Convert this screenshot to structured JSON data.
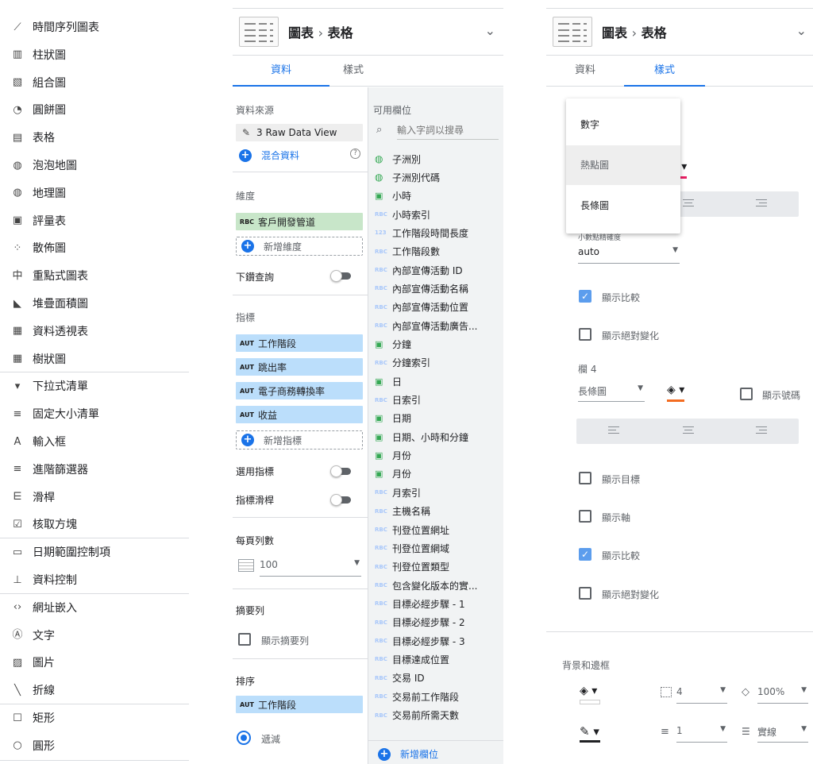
{
  "left_menu": {
    "items": [
      {
        "icon": "time-series-icon",
        "glyph": "⟋",
        "label": "時間序列圖表"
      },
      {
        "icon": "bar-chart-icon",
        "glyph": "▥",
        "label": "柱狀圖"
      },
      {
        "icon": "combo-chart-icon",
        "glyph": "▧",
        "label": "組合圖"
      },
      {
        "icon": "pie-chart-icon",
        "glyph": "◔",
        "label": "圓餅圖"
      },
      {
        "icon": "table-icon",
        "glyph": "▤",
        "label": "表格"
      },
      {
        "icon": "bubble-map-icon",
        "glyph": "◍",
        "label": "泡泡地圖"
      },
      {
        "icon": "geo-map-icon",
        "glyph": "◍",
        "label": "地理圖"
      },
      {
        "icon": "scorecard-icon",
        "glyph": "▣",
        "label": "評量表"
      },
      {
        "icon": "scatter-icon",
        "glyph": "⁘",
        "label": "散佈圖"
      },
      {
        "icon": "bullet-chart-icon",
        "glyph": "中",
        "label": "重點式圖表"
      },
      {
        "icon": "area-chart-icon",
        "glyph": "◣",
        "label": "堆疊面積圖"
      },
      {
        "icon": "pivot-table-icon",
        "glyph": "▦",
        "label": "資料透視表"
      },
      {
        "icon": "treemap-icon",
        "glyph": "▦",
        "label": "樹狀圖"
      },
      {
        "icon": "dropdown-list-icon",
        "glyph": "▾",
        "label": "下拉式清單"
      },
      {
        "icon": "fixed-list-icon",
        "glyph": "≡",
        "label": "固定大小清單"
      },
      {
        "icon": "input-box-icon",
        "glyph": "A",
        "label": "輸入框"
      },
      {
        "icon": "advanced-filter-icon",
        "glyph": "≡",
        "label": "進階篩選器"
      },
      {
        "icon": "slider-icon",
        "glyph": "⋿",
        "label": "滑桿"
      },
      {
        "icon": "checkbox-icon",
        "glyph": "☑",
        "label": "核取方塊"
      },
      {
        "icon": "date-range-icon",
        "glyph": "▭",
        "label": "日期範圍控制項"
      },
      {
        "icon": "data-control-icon",
        "glyph": "⊥",
        "label": "資料控制"
      },
      {
        "icon": "url-embed-icon",
        "glyph": "‹›",
        "label": "網址嵌入"
      },
      {
        "icon": "text-icon",
        "glyph": "Ⓐ",
        "label": "文字"
      },
      {
        "icon": "image-icon",
        "glyph": "▨",
        "label": "圖片"
      },
      {
        "icon": "line-icon",
        "glyph": "╲",
        "label": "折線"
      },
      {
        "icon": "rectangle-icon",
        "glyph": "☐",
        "label": "矩形"
      },
      {
        "icon": "circle-icon",
        "glyph": "○",
        "label": "圓形"
      }
    ]
  },
  "data_panel": {
    "breadcrumb": {
      "chart": "圖表",
      "sep": "›",
      "table": "表格"
    },
    "tabs": [
      "資料",
      "樣式"
    ],
    "data_source_label": "資料來源",
    "data_source": "3 Raw Data View",
    "blend_data": "混合資料",
    "dimension_label": "維度",
    "dimension": {
      "type": "RBC",
      "name": "客戶開發管道"
    },
    "add_dimension": "新增維度",
    "drill_down": "下鑽查詢",
    "metric_label": "指標",
    "metrics": [
      {
        "type": "AUT",
        "name": "工作階段"
      },
      {
        "type": "AUT",
        "name": "跳出率"
      },
      {
        "type": "AUT",
        "name": "電子商務轉換率"
      },
      {
        "type": "AUT",
        "name": "收益"
      }
    ],
    "add_metric": "新增指標",
    "optional_metrics": "選用指標",
    "metric_slider": "指標滑桿",
    "rows_per_page_label": "每頁列數",
    "rows_per_page": "100",
    "summary_label": "摘要列",
    "show_summary": "顯示摘要列",
    "sort_label": "排序",
    "sort_field": {
      "type": "AUT",
      "name": "工作階段"
    },
    "descending": "遞減",
    "available_fields_label": "可用欄位",
    "search_placeholder": "輸入字詞以搜尋",
    "fields": [
      {
        "t": "geo",
        "name": "子洲別"
      },
      {
        "t": "geo",
        "name": "子洲別代碼"
      },
      {
        "t": "cal",
        "name": "小時"
      },
      {
        "t": "RBC",
        "name": "小時索引"
      },
      {
        "t": "123",
        "name": "工作階段時間長度"
      },
      {
        "t": "RBC",
        "name": "工作階段數"
      },
      {
        "t": "RBC",
        "name": "內部宣傳活動 ID"
      },
      {
        "t": "RBC",
        "name": "內部宣傳活動名稱"
      },
      {
        "t": "RBC",
        "name": "內部宣傳活動位置"
      },
      {
        "t": "RBC",
        "name": "內部宣傳活動廣告..."
      },
      {
        "t": "cal",
        "name": "分鐘"
      },
      {
        "t": "RBC",
        "name": "分鐘索引"
      },
      {
        "t": "cal",
        "name": "日"
      },
      {
        "t": "RBC",
        "name": "日索引"
      },
      {
        "t": "cal",
        "name": "日期"
      },
      {
        "t": "cal",
        "name": "日期、小時和分鐘"
      },
      {
        "t": "cal",
        "name": "月份"
      },
      {
        "t": "cal",
        "name": "月份"
      },
      {
        "t": "RBC",
        "name": "月索引"
      },
      {
        "t": "RBC",
        "name": "主機名稱"
      },
      {
        "t": "RBC",
        "name": "刊登位置網址"
      },
      {
        "t": "RBC",
        "name": "刊登位置網域"
      },
      {
        "t": "RBC",
        "name": "刊登位置類型"
      },
      {
        "t": "RBC",
        "name": "包含變化版本的實..."
      },
      {
        "t": "RBC",
        "name": "目標必經步驟 - 1"
      },
      {
        "t": "RBC",
        "name": "目標必經步驟 - 2"
      },
      {
        "t": "RBC",
        "name": "目標必經步驟 - 3"
      },
      {
        "t": "RBC",
        "name": "目標達成位置"
      },
      {
        "t": "RBC",
        "name": "交易 ID"
      },
      {
        "t": "RBC",
        "name": "交易前工作階段"
      },
      {
        "t": "RBC",
        "name": "交易前所需天數"
      }
    ],
    "add_field": "新增欄位"
  },
  "style_panel": {
    "breadcrumb": {
      "chart": "圖表",
      "sep": "›",
      "table": "表格"
    },
    "tabs": [
      "資料",
      "樣式"
    ],
    "menu_options": [
      "數字",
      "熱點圖",
      "長條圖"
    ],
    "decimal_label": "小數點精確度",
    "decimal_value": "auto",
    "show_comparison": "顯示比較",
    "show_abs_change": "顯示絕對變化",
    "column4_label": "欄 4",
    "column4_type": "長條圖",
    "show_number": "顯示號碼",
    "show_target": "顯示目標",
    "show_axis": "顯示軸",
    "show_comparison2": "顯示比較",
    "show_abs_change2": "顯示絕對變化",
    "bg_border_label": "背景和邊框",
    "border_radius": "4",
    "opacity": "100%",
    "border_weight": "1",
    "border_style": "實線",
    "colors": {
      "accent": "#1a73e8",
      "bar_color": "#f36c21",
      "pink": "#e91e63"
    }
  }
}
